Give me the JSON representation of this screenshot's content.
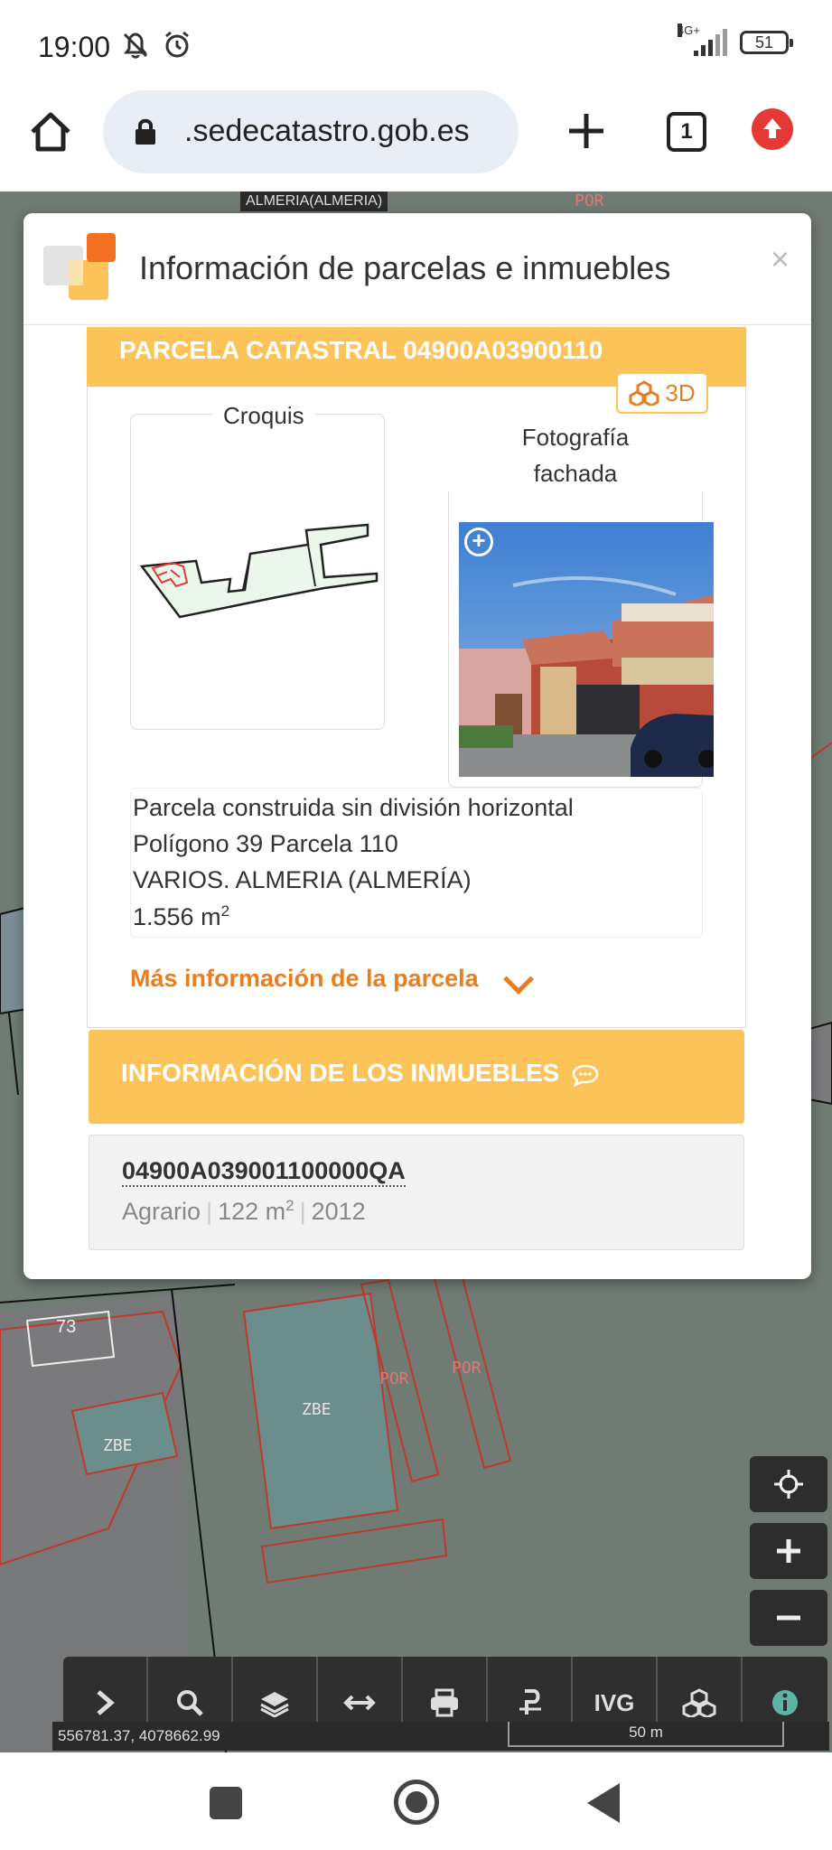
{
  "status_bar": {
    "time": "19:00",
    "network": "4G+",
    "battery": "51"
  },
  "browser": {
    "url": ".sedecatastro.gob.es",
    "tab_count": "1"
  },
  "map": {
    "top_label": "ALMERIA(ALMERIA)",
    "coordinates": "556781.37, 4078662.99",
    "scale": "50 m",
    "labels": {
      "lot_73": "73",
      "zbe_1": "ZBE",
      "zbe_2": "ZBE",
      "por_1": "POR",
      "por_2": "POR",
      "por_top": "POR"
    },
    "toolbar": {
      "ivg": "IVG"
    }
  },
  "modal": {
    "title": "Información de parcelas e inmuebles",
    "close": "×",
    "parcel_header": "PARCELA CATASTRAL 04900A03900110",
    "btn_3d": "3D",
    "croquis_label": "Croquis",
    "foto_label_line1": "Fotografía",
    "foto_label_line2": "fachada",
    "info": {
      "line1": "Parcela construida sin división horizontal",
      "line2": "Polígono 39 Parcela 110",
      "line3": "VARIOS. ALMERIA (ALMERÍA)",
      "area": "1.556 m",
      "area_sup": "2"
    },
    "more_info": "Más información de la parcela",
    "inmuebles_header": "INFORMACIÓN DE LOS INMUEBLES",
    "inmueble": {
      "ref": "04900A039001100000QA",
      "use": "Agrario",
      "area": "122 m",
      "area_sup": "2",
      "year": "2012"
    }
  },
  "colors": {
    "accent_yellow": "#fcc458",
    "accent_orange": "#e67e22",
    "map_bg": "#6e7a72"
  }
}
